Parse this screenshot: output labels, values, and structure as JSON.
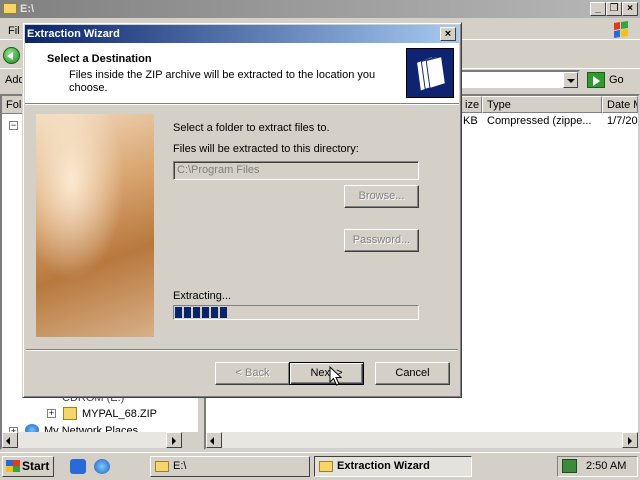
{
  "explorer": {
    "title": "E:\\",
    "menu_first": "Fil",
    "address_label": "Add",
    "go_label": "Go",
    "left_header": "Fol",
    "columns": {
      "size": "ize",
      "type": "Type",
      "date": "Date M"
    },
    "file_row": {
      "size": "KB",
      "type": "Compressed (zippe...",
      "date": "1/7/20"
    },
    "tree": [
      {
        "label": "CDROM (E:)"
      },
      {
        "label": "MYPAL_68.ZIP"
      },
      {
        "label": "My Network Places"
      }
    ],
    "caption_buttons": {
      "minimize": "_",
      "restore": "❐",
      "close": "×"
    }
  },
  "dialog": {
    "title": "Extraction Wizard",
    "close_glyph": "×",
    "header_title": "Select a Destination",
    "header_subtitle": "Files inside the ZIP archive will be extracted to the location you choose.",
    "select_label": "Select a folder to extract files to.",
    "directory_label": "Files will be extracted to this directory:",
    "directory_value": "C:\\Program Files",
    "browse_label": "Browse...",
    "password_label": "Password...",
    "extracting_label": "Extracting...",
    "progress_fraction": 0.22,
    "back_label": "< Back",
    "next_label": "Next >",
    "cancel_label": "Cancel"
  },
  "taskbar": {
    "start_label": "Start",
    "tasks": [
      {
        "label": "E:\\"
      },
      {
        "label": "Extraction Wizard"
      }
    ],
    "clock": "2:50 AM"
  },
  "colors": {
    "title_active": "#0a246a",
    "progress": "#0a246a",
    "face": "#d4d0c8"
  }
}
